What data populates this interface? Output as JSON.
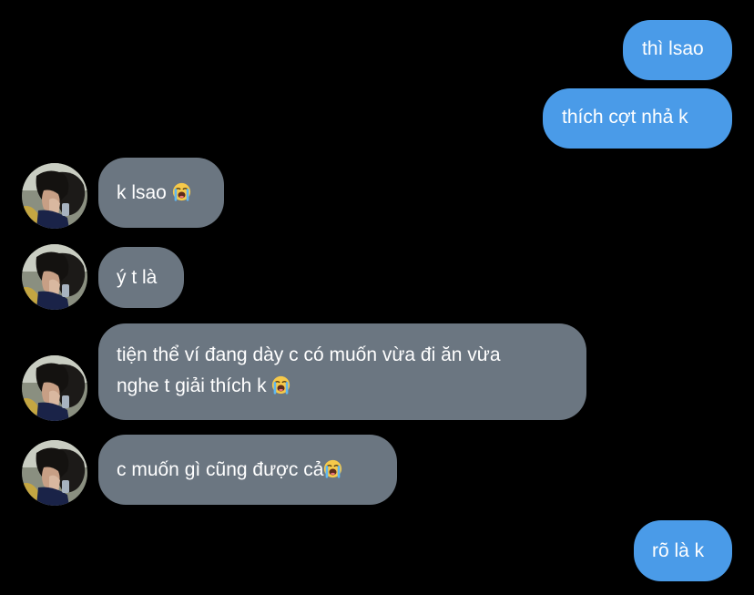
{
  "chat": {
    "messages": [
      {
        "id": "m1",
        "direction": "outgoing",
        "text": "thì lsao"
      },
      {
        "id": "m2",
        "direction": "outgoing",
        "text": "thích cợt nhả k"
      },
      {
        "id": "m3",
        "direction": "incoming",
        "text": "k lsao",
        "emoji": "loudly-crying-face"
      },
      {
        "id": "m4",
        "direction": "incoming",
        "text": "ý t là"
      },
      {
        "id": "m5",
        "direction": "incoming",
        "line1": "tiện thể ví đang dày c có muốn vừa đi ăn vừa",
        "line2": "nghe t giải thích k",
        "emoji": "loudly-crying-face"
      },
      {
        "id": "m6",
        "direction": "incoming",
        "text": "c muốn gì cũng được cả",
        "emoji": "loudly-crying-face"
      },
      {
        "id": "m7",
        "direction": "outgoing",
        "text": "rõ là k"
      }
    ]
  },
  "colors": {
    "background": "#000000",
    "outgoing_bubble": "#4a9be8",
    "incoming_bubble": "#6b7681",
    "text": "#ffffff"
  }
}
